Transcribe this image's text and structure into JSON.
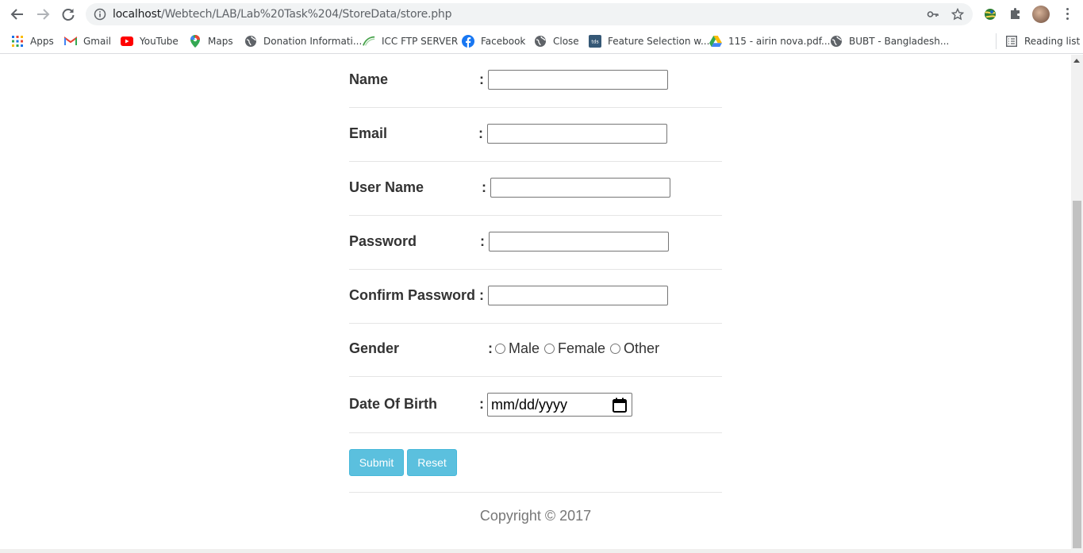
{
  "browser": {
    "url_host": "localhost",
    "url_path": "/Webtech/LAB/Lab%20Task%204/StoreData/store.php",
    "bookmarks": [
      {
        "label": "Apps",
        "icon": "apps-grid-icon"
      },
      {
        "label": "Gmail",
        "icon": "gmail-icon"
      },
      {
        "label": "YouTube",
        "icon": "youtube-icon"
      },
      {
        "label": "Maps",
        "icon": "maps-icon"
      },
      {
        "label": "Donation Informati...",
        "icon": "globe-icon"
      },
      {
        "label": "ICC FTP SERVER",
        "icon": "icc-icon"
      },
      {
        "label": "Facebook",
        "icon": "facebook-icon"
      },
      {
        "label": "Close",
        "icon": "globe-icon"
      },
      {
        "label": "Feature Selection w...",
        "icon": "tds-icon"
      },
      {
        "label": "115 - airin nova.pdf...",
        "icon": "google-drive-icon"
      },
      {
        "label": "BUBT - Bangladesh...",
        "icon": "globe-icon"
      }
    ],
    "reading_list": "Reading list"
  },
  "form": {
    "name_label": "Name",
    "email_label": "Email",
    "username_label": "User Name",
    "password_label": "Password",
    "confirm_password_label": "Confirm Password",
    "gender_label": "Gender",
    "gender_options": [
      "Male",
      "Female",
      "Other"
    ],
    "dob_label": "Date Of Birth",
    "dob_placeholder": "mm/dd/yyyy",
    "colon": ":",
    "submit_label": "Submit",
    "reset_label": "Reset"
  },
  "footer": {
    "copyright": "Copyright © 2017"
  },
  "colors": {
    "button_bg": "#5bc0de",
    "label_text": "#333333",
    "footer_text": "#777777"
  }
}
